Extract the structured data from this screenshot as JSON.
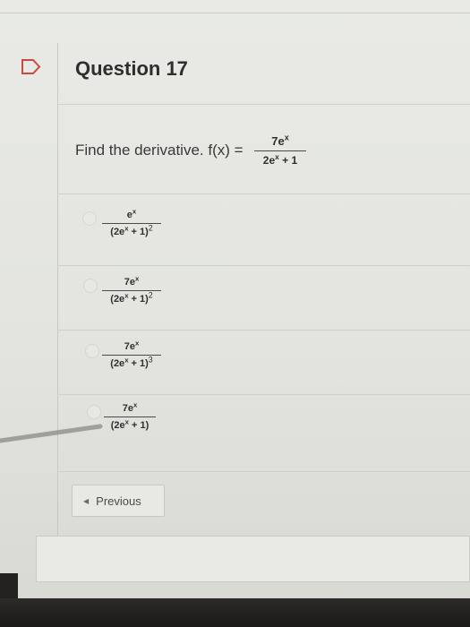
{
  "question": {
    "title": "Question 17",
    "prompt": "Find the derivative. f(x) =",
    "function": {
      "numerator": "7e",
      "numerator_sup": "x",
      "den_left": "2e",
      "den_sup": "x",
      "den_right": " + 1"
    }
  },
  "options": [
    {
      "num": "e",
      "num_sup": "x",
      "den": "(2e",
      "den_sup": "x",
      "den_mid": " + 1)",
      "den_pow": "2"
    },
    {
      "num": "7e",
      "num_sup": "x",
      "den": "(2e",
      "den_sup": "x",
      "den_mid": " + 1)",
      "den_pow": "2"
    },
    {
      "num": "7e",
      "num_sup": "x",
      "den": "(2e",
      "den_sup": "x",
      "den_mid": " + 1)",
      "den_pow": "3"
    },
    {
      "num": "7e",
      "num_sup": "x",
      "den": "(2e",
      "den_sup": "x",
      "den_mid": " + 1)",
      "den_pow": ""
    }
  ],
  "navigation": {
    "previous_label": "Previous",
    "previous_icon": "chevron-left-icon"
  },
  "colors": {
    "background": "#e6e7e2",
    "text": "#3c3c3c",
    "border": "#c9cac5",
    "bezel": "#1f1e1d"
  }
}
